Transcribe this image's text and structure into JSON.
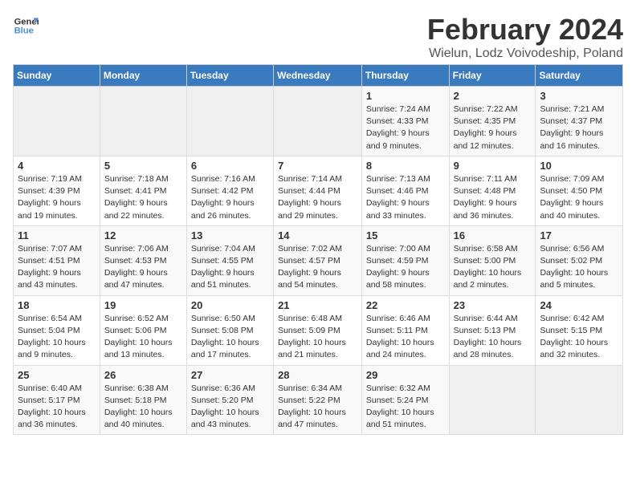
{
  "logo": {
    "line1": "General",
    "line2": "Blue"
  },
  "title": "February 2024",
  "subtitle": "Wielun, Lodz Voivodeship, Poland",
  "days_of_week": [
    "Sunday",
    "Monday",
    "Tuesday",
    "Wednesday",
    "Thursday",
    "Friday",
    "Saturday"
  ],
  "weeks": [
    [
      {
        "day": "",
        "info": ""
      },
      {
        "day": "",
        "info": ""
      },
      {
        "day": "",
        "info": ""
      },
      {
        "day": "",
        "info": ""
      },
      {
        "day": "1",
        "info": "Sunrise: 7:24 AM\nSunset: 4:33 PM\nDaylight: 9 hours\nand 9 minutes."
      },
      {
        "day": "2",
        "info": "Sunrise: 7:22 AM\nSunset: 4:35 PM\nDaylight: 9 hours\nand 12 minutes."
      },
      {
        "day": "3",
        "info": "Sunrise: 7:21 AM\nSunset: 4:37 PM\nDaylight: 9 hours\nand 16 minutes."
      }
    ],
    [
      {
        "day": "4",
        "info": "Sunrise: 7:19 AM\nSunset: 4:39 PM\nDaylight: 9 hours\nand 19 minutes."
      },
      {
        "day": "5",
        "info": "Sunrise: 7:18 AM\nSunset: 4:41 PM\nDaylight: 9 hours\nand 22 minutes."
      },
      {
        "day": "6",
        "info": "Sunrise: 7:16 AM\nSunset: 4:42 PM\nDaylight: 9 hours\nand 26 minutes."
      },
      {
        "day": "7",
        "info": "Sunrise: 7:14 AM\nSunset: 4:44 PM\nDaylight: 9 hours\nand 29 minutes."
      },
      {
        "day": "8",
        "info": "Sunrise: 7:13 AM\nSunset: 4:46 PM\nDaylight: 9 hours\nand 33 minutes."
      },
      {
        "day": "9",
        "info": "Sunrise: 7:11 AM\nSunset: 4:48 PM\nDaylight: 9 hours\nand 36 minutes."
      },
      {
        "day": "10",
        "info": "Sunrise: 7:09 AM\nSunset: 4:50 PM\nDaylight: 9 hours\nand 40 minutes."
      }
    ],
    [
      {
        "day": "11",
        "info": "Sunrise: 7:07 AM\nSunset: 4:51 PM\nDaylight: 9 hours\nand 43 minutes."
      },
      {
        "day": "12",
        "info": "Sunrise: 7:06 AM\nSunset: 4:53 PM\nDaylight: 9 hours\nand 47 minutes."
      },
      {
        "day": "13",
        "info": "Sunrise: 7:04 AM\nSunset: 4:55 PM\nDaylight: 9 hours\nand 51 minutes."
      },
      {
        "day": "14",
        "info": "Sunrise: 7:02 AM\nSunset: 4:57 PM\nDaylight: 9 hours\nand 54 minutes."
      },
      {
        "day": "15",
        "info": "Sunrise: 7:00 AM\nSunset: 4:59 PM\nDaylight: 9 hours\nand 58 minutes."
      },
      {
        "day": "16",
        "info": "Sunrise: 6:58 AM\nSunset: 5:00 PM\nDaylight: 10 hours\nand 2 minutes."
      },
      {
        "day": "17",
        "info": "Sunrise: 6:56 AM\nSunset: 5:02 PM\nDaylight: 10 hours\nand 5 minutes."
      }
    ],
    [
      {
        "day": "18",
        "info": "Sunrise: 6:54 AM\nSunset: 5:04 PM\nDaylight: 10 hours\nand 9 minutes."
      },
      {
        "day": "19",
        "info": "Sunrise: 6:52 AM\nSunset: 5:06 PM\nDaylight: 10 hours\nand 13 minutes."
      },
      {
        "day": "20",
        "info": "Sunrise: 6:50 AM\nSunset: 5:08 PM\nDaylight: 10 hours\nand 17 minutes."
      },
      {
        "day": "21",
        "info": "Sunrise: 6:48 AM\nSunset: 5:09 PM\nDaylight: 10 hours\nand 21 minutes."
      },
      {
        "day": "22",
        "info": "Sunrise: 6:46 AM\nSunset: 5:11 PM\nDaylight: 10 hours\nand 24 minutes."
      },
      {
        "day": "23",
        "info": "Sunrise: 6:44 AM\nSunset: 5:13 PM\nDaylight: 10 hours\nand 28 minutes."
      },
      {
        "day": "24",
        "info": "Sunrise: 6:42 AM\nSunset: 5:15 PM\nDaylight: 10 hours\nand 32 minutes."
      }
    ],
    [
      {
        "day": "25",
        "info": "Sunrise: 6:40 AM\nSunset: 5:17 PM\nDaylight: 10 hours\nand 36 minutes."
      },
      {
        "day": "26",
        "info": "Sunrise: 6:38 AM\nSunset: 5:18 PM\nDaylight: 10 hours\nand 40 minutes."
      },
      {
        "day": "27",
        "info": "Sunrise: 6:36 AM\nSunset: 5:20 PM\nDaylight: 10 hours\nand 43 minutes."
      },
      {
        "day": "28",
        "info": "Sunrise: 6:34 AM\nSunset: 5:22 PM\nDaylight: 10 hours\nand 47 minutes."
      },
      {
        "day": "29",
        "info": "Sunrise: 6:32 AM\nSunset: 5:24 PM\nDaylight: 10 hours\nand 51 minutes."
      },
      {
        "day": "",
        "info": ""
      },
      {
        "day": "",
        "info": ""
      }
    ]
  ]
}
